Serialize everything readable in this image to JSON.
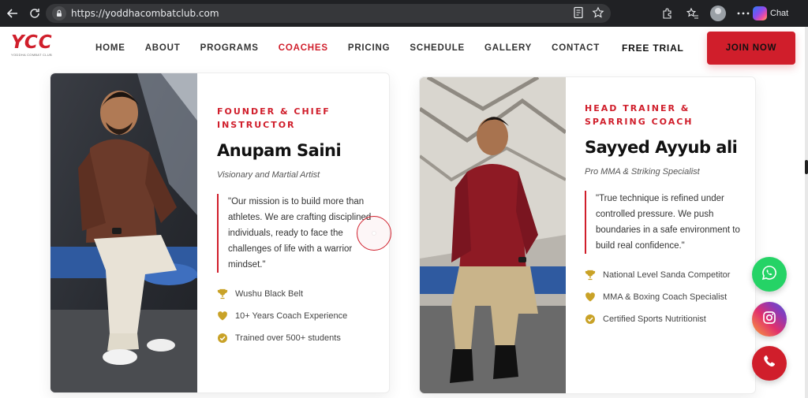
{
  "browser": {
    "url": "https://yoddhacombatclub.com",
    "chat_label": "Chat"
  },
  "header": {
    "logo_text": "YCC",
    "logo_tagline": "YODDHA COMBAT CLUB",
    "nav": [
      "HOME",
      "ABOUT",
      "PROGRAMS",
      "COACHES",
      "PRICING",
      "SCHEDULE",
      "GALLERY",
      "CONTACT"
    ],
    "active_nav": "COACHES",
    "free_trial": "FREE TRIAL",
    "join_now": "JOIN NOW"
  },
  "coaches": [
    {
      "role": "FOUNDER & CHIEF INSTRUCTOR",
      "name": "Anupam Saini",
      "subtitle": "Visionary and Martial Artist",
      "quote": "\"Our mission is to build more than athletes. We are crafting disciplined individuals, ready to face the challenges of life with a warrior mindset.\"",
      "features": [
        {
          "icon": "trophy-icon",
          "text": "Wushu Black Belt"
        },
        {
          "icon": "heart-icon",
          "text": "10+ Years Coach Experience"
        },
        {
          "icon": "check-circle-icon",
          "text": "Trained over 500+ students"
        }
      ]
    },
    {
      "role": "HEAD TRAINER & SPARRING COACH",
      "name": "Sayyed Ayyub ali",
      "subtitle": "Pro MMA & Striking Specialist",
      "quote": "\"True technique is refined under controlled pressure. We push boundaries in a safe environment to build real confidence.\"",
      "features": [
        {
          "icon": "trophy-icon",
          "text": "National Level Sanda Competitor"
        },
        {
          "icon": "heart-icon",
          "text": "MMA & Boxing Coach Specialist"
        },
        {
          "icon": "check-circle-icon",
          "text": "Certified Sports Nutritionist"
        }
      ]
    }
  ],
  "colors": {
    "accent": "#d01e2b",
    "icon_gold": "#c9a227",
    "whatsapp": "#25d366"
  }
}
